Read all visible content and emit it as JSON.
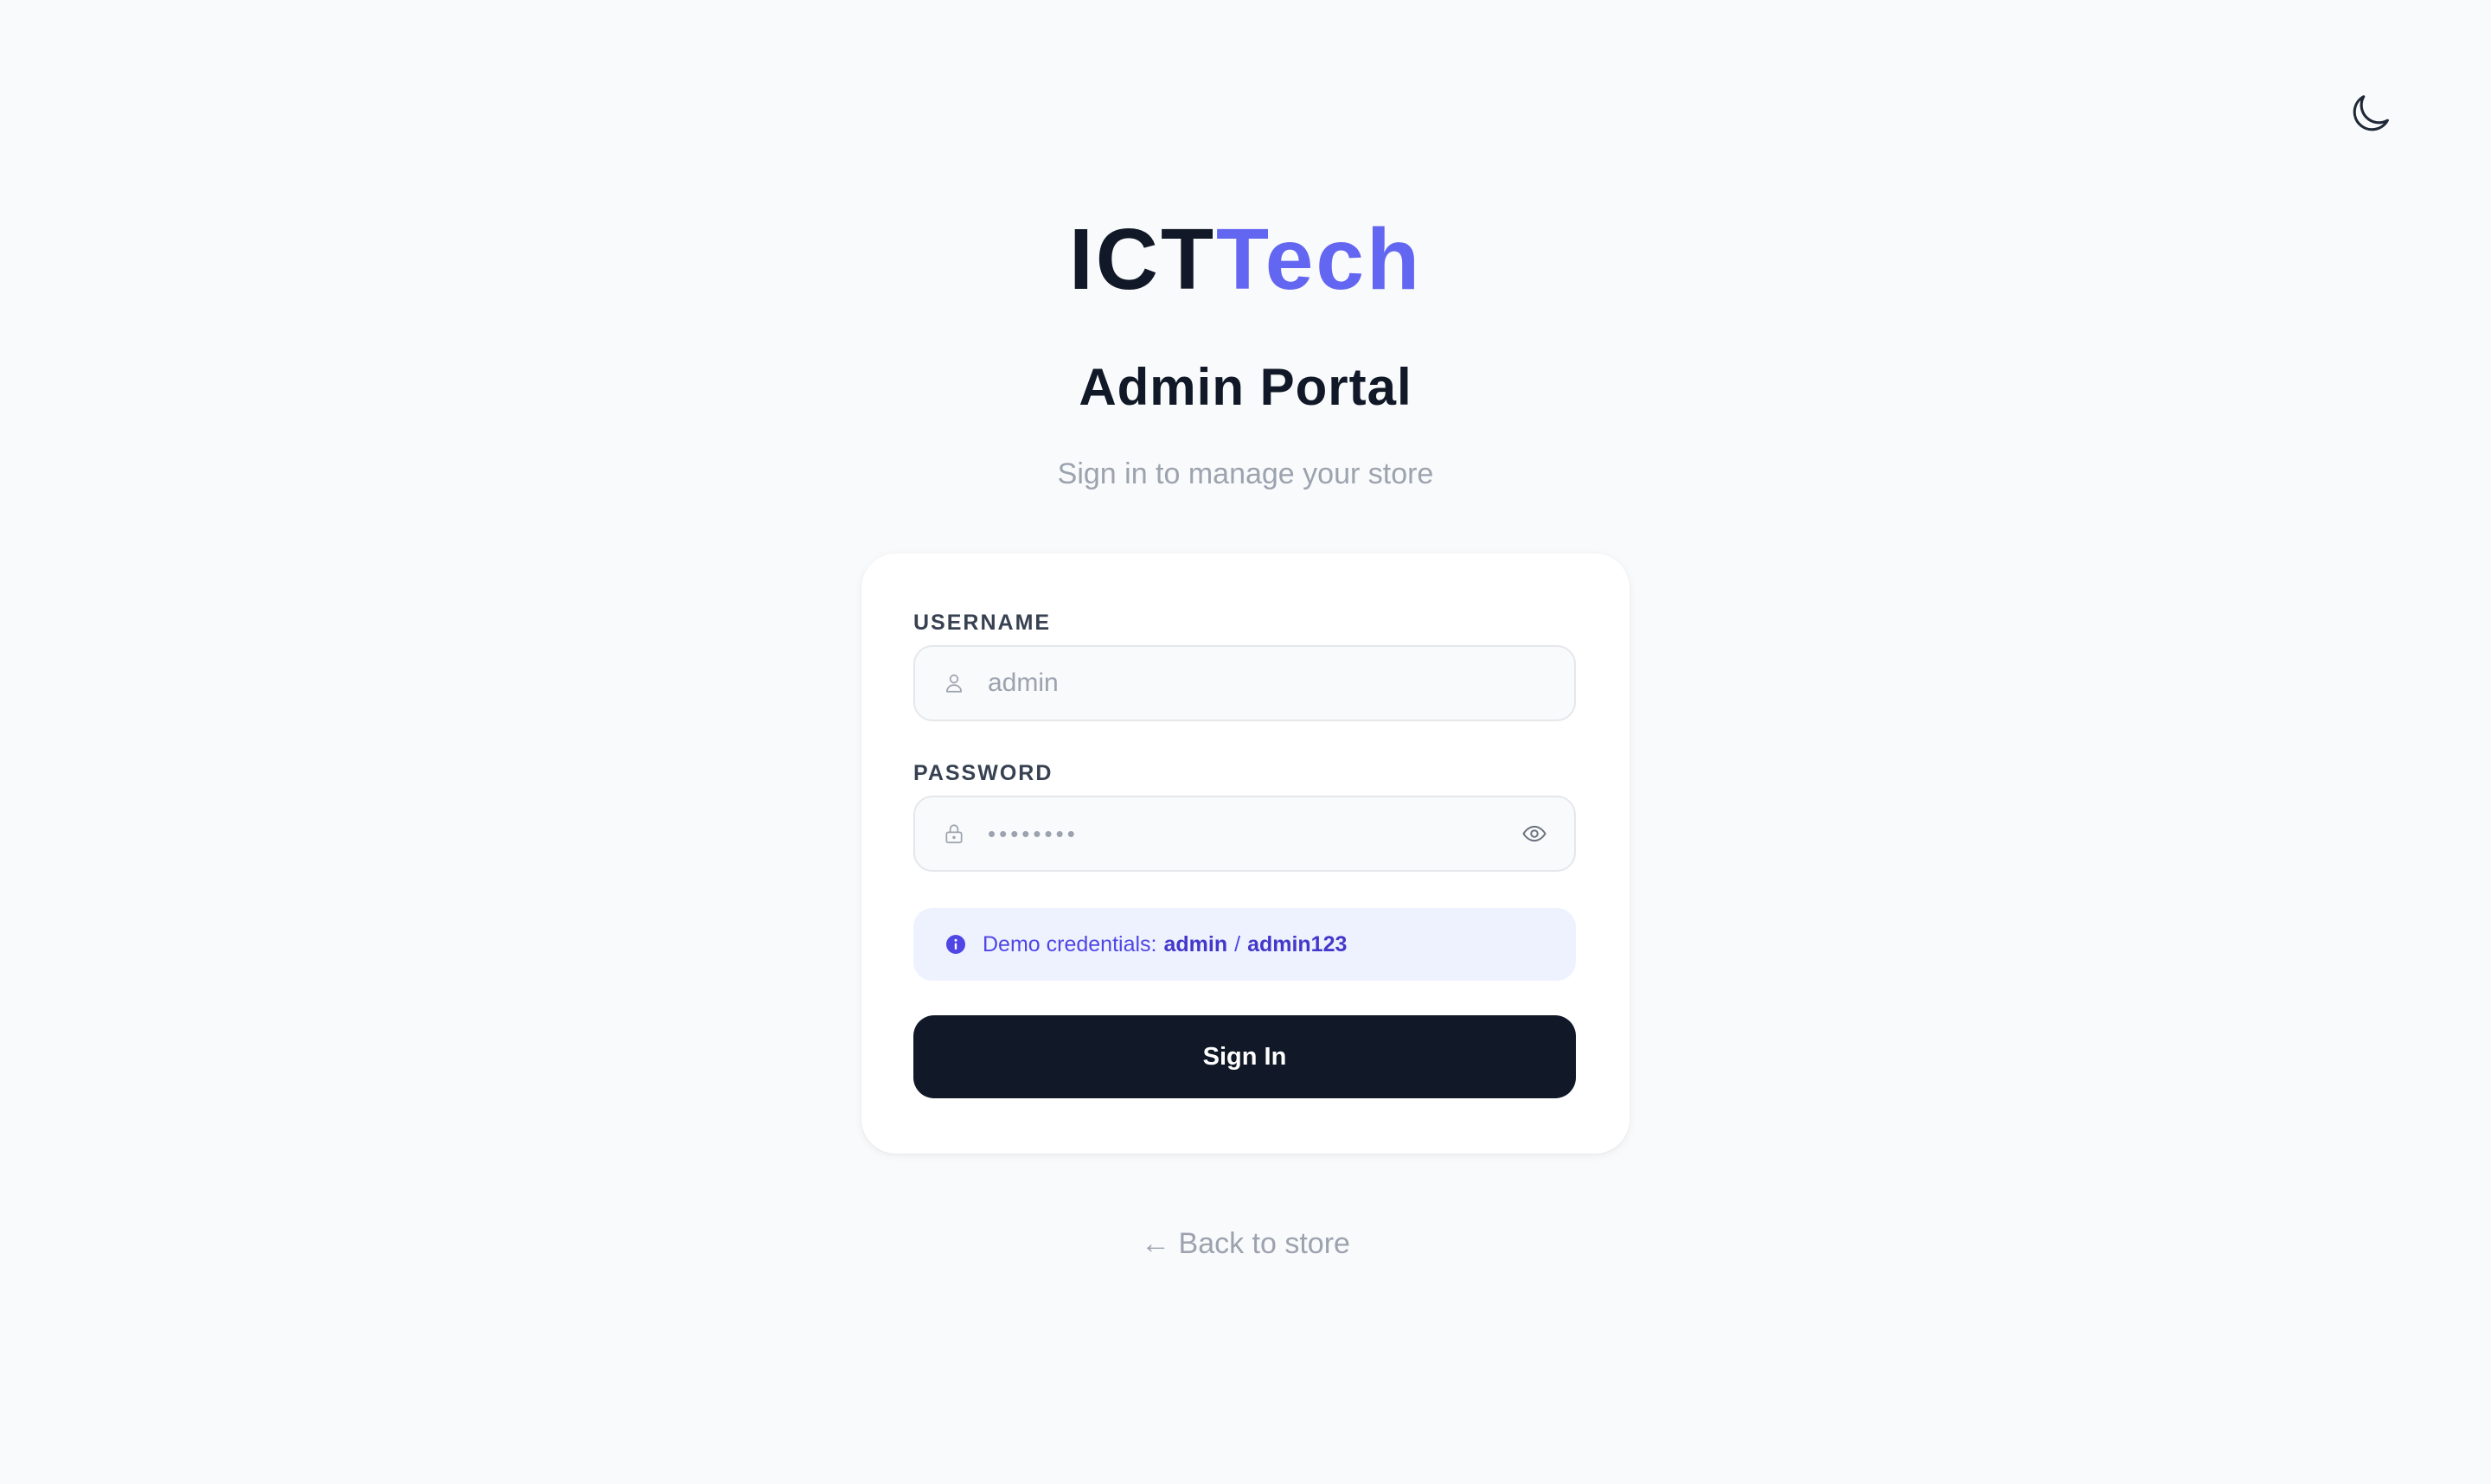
{
  "header": {
    "logo_part1": "ICT",
    "logo_part2": "Tech",
    "title": "Admin Portal",
    "subtitle": "Sign in to manage your store"
  },
  "theme_toggle": {
    "icon": "moon-icon"
  },
  "form": {
    "username": {
      "label": "USERNAME",
      "placeholder": "admin",
      "icon": "user-icon"
    },
    "password": {
      "label": "PASSWORD",
      "masked_value": "••••••••",
      "icon": "lock-icon",
      "toggle_icon": "eye-icon"
    },
    "notice": {
      "prefix": "Demo credentials:",
      "user": "admin",
      "separator": "/",
      "pass": "admin123",
      "icon": "info-icon"
    },
    "submit_label": "Sign In"
  },
  "back_link": {
    "arrow": "←",
    "label": "Back to store"
  },
  "colors": {
    "accent": "#6366f1",
    "background": "#f9fafb",
    "button": "#111827",
    "notice_bg": "#eef2ff",
    "muted_text": "#9ca3af"
  }
}
